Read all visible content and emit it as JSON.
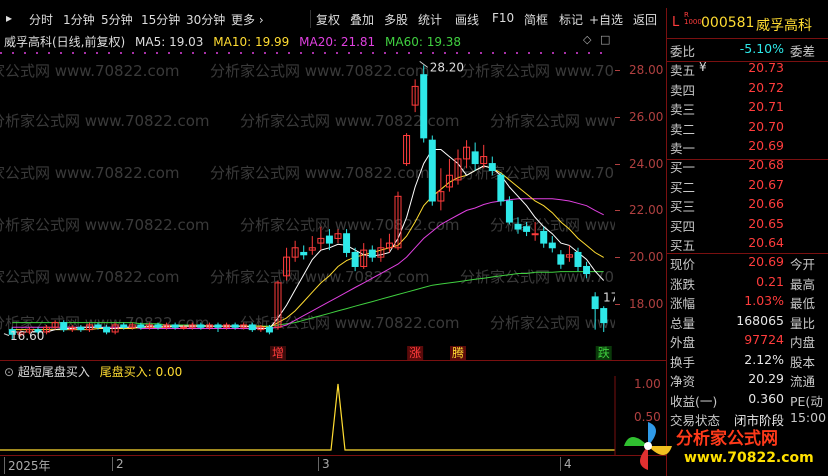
{
  "toolbar": {
    "periods": [
      "分时",
      "1分钟",
      "5分钟",
      "15分钟",
      "30分钟",
      "更多 ›"
    ],
    "buttons": [
      "复权",
      "叠加",
      "多股",
      "统计",
      "画线",
      "F10",
      "简框",
      "标记",
      "+自选",
      "返回"
    ]
  },
  "chart": {
    "title": "威孚高科(日线,前复权)",
    "ma5": "MA5: 19.03",
    "ma10": "MA10: 19.99",
    "ma20": "MA20: 21.81",
    "ma60": "MA60: 19.38",
    "high_label": "28.20",
    "low_label": "16.60",
    "right_edge_label": "17",
    "price_ticks": [
      "28.00",
      "26.00",
      "24.00",
      "22.00",
      "20.00",
      "18.00"
    ],
    "date_labels": [
      "2025年",
      "2",
      "3",
      "4"
    ],
    "markers": [
      "增",
      "涨",
      "腾",
      "跌"
    ],
    "watermark": "分析家公式网 www.70822.com",
    "colors": {
      "up": "#ff3c3c",
      "down": "#2ee8e8",
      "ma5": "#ffffff",
      "ma10": "#ffdc32",
      "ma20": "#e040e0",
      "ma60": "#40d040"
    },
    "candles": [
      {
        "o": 16.9,
        "c": 16.7,
        "h": 17.0,
        "l": 16.5
      },
      {
        "o": 16.7,
        "c": 16.8,
        "h": 16.9,
        "l": 16.6
      },
      {
        "o": 16.8,
        "c": 16.9,
        "h": 17.0,
        "l": 16.7
      },
      {
        "o": 16.9,
        "c": 16.8,
        "h": 17.0,
        "l": 16.7
      },
      {
        "o": 16.8,
        "c": 17.0,
        "h": 17.1,
        "l": 16.7
      },
      {
        "o": 17.0,
        "c": 17.2,
        "h": 17.3,
        "l": 16.9
      },
      {
        "o": 17.2,
        "c": 16.9,
        "h": 17.3,
        "l": 16.8
      },
      {
        "o": 16.9,
        "c": 17.0,
        "h": 17.1,
        "l": 16.8
      },
      {
        "o": 17.0,
        "c": 16.9,
        "h": 17.1,
        "l": 16.8
      },
      {
        "o": 16.9,
        "c": 17.1,
        "h": 17.2,
        "l": 16.8
      },
      {
        "o": 17.1,
        "c": 17.0,
        "h": 17.2,
        "l": 16.9
      },
      {
        "o": 17.0,
        "c": 16.8,
        "h": 17.1,
        "l": 16.7
      },
      {
        "o": 16.8,
        "c": 17.1,
        "h": 17.2,
        "l": 16.7
      },
      {
        "o": 17.1,
        "c": 17.0,
        "h": 17.2,
        "l": 16.9
      },
      {
        "o": 17.0,
        "c": 17.1,
        "h": 17.2,
        "l": 16.9
      },
      {
        "o": 17.1,
        "c": 17.0,
        "h": 17.2,
        "l": 16.9
      },
      {
        "o": 17.0,
        "c": 17.1,
        "h": 17.2,
        "l": 16.9
      },
      {
        "o": 17.1,
        "c": 17.0,
        "h": 17.2,
        "l": 16.9
      },
      {
        "o": 17.0,
        "c": 17.1,
        "h": 17.2,
        "l": 16.9
      },
      {
        "o": 17.1,
        "c": 17.0,
        "h": 17.2,
        "l": 16.9
      },
      {
        "o": 17.0,
        "c": 17.0,
        "h": 17.1,
        "l": 16.9
      },
      {
        "o": 17.0,
        "c": 17.1,
        "h": 17.2,
        "l": 16.9
      },
      {
        "o": 17.1,
        "c": 17.0,
        "h": 17.2,
        "l": 16.9
      },
      {
        "o": 17.0,
        "c": 17.1,
        "h": 17.2,
        "l": 16.9
      },
      {
        "o": 17.1,
        "c": 17.0,
        "h": 17.2,
        "l": 16.8
      },
      {
        "o": 17.0,
        "c": 17.1,
        "h": 17.2,
        "l": 16.9
      },
      {
        "o": 17.1,
        "c": 17.0,
        "h": 17.2,
        "l": 16.9
      },
      {
        "o": 17.0,
        "c": 17.1,
        "h": 17.2,
        "l": 16.9
      },
      {
        "o": 17.1,
        "c": 16.9,
        "h": 17.2,
        "l": 16.8
      },
      {
        "o": 16.9,
        "c": 17.0,
        "h": 17.1,
        "l": 16.8
      },
      {
        "o": 17.0,
        "c": 16.8,
        "h": 17.1,
        "l": 16.7
      },
      {
        "o": 17.0,
        "c": 18.9,
        "h": 19.0,
        "l": 16.9
      },
      {
        "o": 19.2,
        "c": 20.0,
        "h": 20.4,
        "l": 19.0
      },
      {
        "o": 20.0,
        "c": 20.4,
        "h": 20.7,
        "l": 19.8
      },
      {
        "o": 20.2,
        "c": 20.1,
        "h": 20.5,
        "l": 19.9
      },
      {
        "o": 20.3,
        "c": 20.4,
        "h": 20.9,
        "l": 20.1
      },
      {
        "o": 20.6,
        "c": 20.8,
        "h": 21.3,
        "l": 20.3
      },
      {
        "o": 20.9,
        "c": 20.6,
        "h": 21.2,
        "l": 20.3
      },
      {
        "o": 20.8,
        "c": 21.0,
        "h": 21.2,
        "l": 20.6
      },
      {
        "o": 21.0,
        "c": 20.2,
        "h": 21.2,
        "l": 20.0
      },
      {
        "o": 20.2,
        "c": 19.6,
        "h": 20.4,
        "l": 19.4
      },
      {
        "o": 19.6,
        "c": 20.3,
        "h": 20.6,
        "l": 19.5
      },
      {
        "o": 20.3,
        "c": 20.0,
        "h": 20.5,
        "l": 19.8
      },
      {
        "o": 20.0,
        "c": 20.4,
        "h": 20.8,
        "l": 19.8
      },
      {
        "o": 20.4,
        "c": 20.6,
        "h": 21.0,
        "l": 20.2
      },
      {
        "o": 20.4,
        "c": 22.6,
        "h": 22.8,
        "l": 20.3
      },
      {
        "o": 24.0,
        "c": 25.2,
        "h": 25.3,
        "l": 23.9
      },
      {
        "o": 26.5,
        "c": 27.3,
        "h": 27.6,
        "l": 26.2
      },
      {
        "o": 27.8,
        "c": 25.1,
        "h": 28.2,
        "l": 24.9
      },
      {
        "o": 25.0,
        "c": 22.4,
        "h": 25.2,
        "l": 22.2
      },
      {
        "o": 22.4,
        "c": 22.8,
        "h": 23.8,
        "l": 22.0
      },
      {
        "o": 23.0,
        "c": 23.5,
        "h": 24.2,
        "l": 22.8
      },
      {
        "o": 23.3,
        "c": 24.2,
        "h": 24.6,
        "l": 23.1
      },
      {
        "o": 24.2,
        "c": 24.7,
        "h": 25.0,
        "l": 23.8
      },
      {
        "o": 24.5,
        "c": 24.0,
        "h": 24.9,
        "l": 23.7
      },
      {
        "o": 24.0,
        "c": 24.3,
        "h": 24.8,
        "l": 23.8
      },
      {
        "o": 24.0,
        "c": 23.7,
        "h": 24.3,
        "l": 23.5
      },
      {
        "o": 23.5,
        "c": 22.4,
        "h": 23.6,
        "l": 22.2
      },
      {
        "o": 22.4,
        "c": 21.5,
        "h": 22.6,
        "l": 21.4
      },
      {
        "o": 21.4,
        "c": 21.2,
        "h": 21.7,
        "l": 21.0
      },
      {
        "o": 21.3,
        "c": 21.1,
        "h": 21.5,
        "l": 20.9
      },
      {
        "o": 21.0,
        "c": 21.0,
        "h": 21.5,
        "l": 20.7
      },
      {
        "o": 21.1,
        "c": 20.6,
        "h": 21.3,
        "l": 20.4
      },
      {
        "o": 20.6,
        "c": 20.4,
        "h": 20.9,
        "l": 20.2
      },
      {
        "o": 20.1,
        "c": 19.7,
        "h": 20.3,
        "l": 19.5
      },
      {
        "o": 20.0,
        "c": 20.1,
        "h": 20.5,
        "l": 19.8
      },
      {
        "o": 20.2,
        "c": 19.6,
        "h": 20.4,
        "l": 19.4
      },
      {
        "o": 19.6,
        "c": 19.3,
        "h": 19.8,
        "l": 19.1
      },
      {
        "o": 18.3,
        "c": 17.8,
        "h": 18.5,
        "l": 16.9
      },
      {
        "o": 17.8,
        "c": 17.2,
        "h": 17.9,
        "l": 16.8
      }
    ],
    "ma5_series": [
      16.8,
      16.8,
      16.8,
      16.8,
      16.8,
      16.9,
      16.95,
      16.95,
      17.0,
      17.0,
      17.0,
      16.95,
      16.95,
      17.0,
      17.0,
      17.0,
      17.05,
      17.05,
      17.05,
      17.05,
      17.05,
      17.05,
      17.05,
      17.05,
      17.05,
      17.05,
      17.05,
      17.05,
      17.0,
      16.95,
      16.95,
      17.4,
      17.95,
      18.6,
      19.25,
      19.9,
      20.3,
      20.4,
      20.55,
      20.5,
      20.3,
      20.1,
      20.05,
      20.1,
      20.2,
      20.8,
      21.7,
      23.0,
      24.0,
      24.6,
      24.6,
      24.3,
      24.0,
      23.5,
      23.7,
      23.9,
      23.8,
      23.5,
      23.0,
      22.6,
      22.2,
      21.7,
      21.3,
      21.0,
      20.6,
      20.5,
      20.2,
      19.9,
      19.4,
      19.0
    ],
    "ma10_series": [
      16.9,
      16.9,
      16.9,
      16.9,
      16.9,
      16.9,
      16.9,
      16.9,
      16.9,
      16.9,
      16.95,
      16.95,
      16.95,
      16.95,
      16.95,
      17.0,
      17.0,
      17.0,
      17.0,
      17.05,
      17.05,
      17.05,
      17.05,
      17.05,
      17.05,
      17.05,
      17.05,
      17.05,
      17.05,
      17.05,
      17.0,
      17.2,
      17.4,
      17.7,
      18.1,
      18.5,
      18.9,
      19.2,
      19.6,
      19.85,
      20.0,
      20.1,
      20.2,
      20.3,
      20.4,
      20.5,
      20.9,
      21.5,
      22.2,
      22.6,
      22.9,
      23.2,
      23.4,
      23.5,
      23.7,
      23.9,
      23.8,
      23.6,
      23.3,
      23.0,
      22.7,
      22.4,
      22.2,
      21.9,
      21.5,
      21.2,
      20.8,
      20.5,
      20.2,
      19.99
    ],
    "ma20_series": [
      17.0,
      17.0,
      17.0,
      17.0,
      17.0,
      17.0,
      17.0,
      17.0,
      17.0,
      17.0,
      17.0,
      17.0,
      17.0,
      17.0,
      17.0,
      16.95,
      16.95,
      16.95,
      16.95,
      16.95,
      16.95,
      16.95,
      16.95,
      16.95,
      16.95,
      16.95,
      16.95,
      16.95,
      16.95,
      16.95,
      16.95,
      17.0,
      17.1,
      17.3,
      17.5,
      17.7,
      17.9,
      18.1,
      18.3,
      18.5,
      18.7,
      18.9,
      19.1,
      19.3,
      19.5,
      19.7,
      20.0,
      20.4,
      20.8,
      21.1,
      21.4,
      21.6,
      21.8,
      22.0,
      22.1,
      22.25,
      22.35,
      22.4,
      22.45,
      22.5,
      22.5,
      22.5,
      22.5,
      22.5,
      22.45,
      22.4,
      22.3,
      22.2,
      22.0,
      21.81
    ],
    "ma60_series": [
      17.2,
      17.2,
      17.2,
      17.2,
      17.2,
      17.2,
      17.2,
      17.2,
      17.2,
      17.2,
      17.2,
      17.2,
      17.2,
      17.2,
      17.2,
      17.15,
      17.15,
      17.15,
      17.1,
      17.1,
      17.1,
      17.1,
      17.1,
      17.05,
      17.05,
      17.05,
      17.05,
      17.05,
      17.05,
      17.05,
      17.05,
      17.1,
      17.15,
      17.2,
      17.3,
      17.4,
      17.5,
      17.6,
      17.7,
      17.8,
      17.9,
      18.0,
      18.1,
      18.2,
      18.3,
      18.4,
      18.5,
      18.6,
      18.7,
      18.8,
      18.85,
      18.9,
      18.95,
      19.0,
      19.05,
      19.1,
      19.15,
      19.2,
      19.25,
      19.3,
      19.3,
      19.35,
      19.35,
      19.35,
      19.38,
      19.38,
      19.38,
      19.38,
      19.38,
      19.38
    ]
  },
  "indicator": {
    "name": "超短尾盘买入",
    "series_label": "尾盘买入: 0.00",
    "ticks": [
      "1.00",
      "0.50"
    ],
    "signal_values": [
      0,
      0,
      0,
      0,
      0,
      0,
      0,
      0,
      0,
      0,
      0,
      0,
      0,
      0,
      0,
      0,
      0,
      0,
      0,
      0,
      0,
      0,
      0,
      0,
      0,
      0,
      0,
      0,
      0,
      0,
      0,
      0,
      0,
      0,
      0,
      0,
      0,
      0,
      0,
      0,
      0,
      0,
      0,
      0,
      0,
      0,
      0,
      0,
      0,
      0,
      0,
      0,
      0,
      0,
      0,
      0,
      0,
      0,
      0,
      0,
      0,
      0,
      0,
      0,
      0,
      0,
      0,
      0,
      0,
      0
    ],
    "spike_value": 1.0
  },
  "quote": {
    "code": "000581",
    "name": "威孚高科",
    "weibi_label": "委比",
    "weibi_value": "-5.10%",
    "weicha_label": "委差",
    "asks": [
      {
        "label": "卖五",
        "price": "20.73"
      },
      {
        "label": "卖四",
        "price": "20.72"
      },
      {
        "label": "卖三",
        "price": "20.71"
      },
      {
        "label": "卖二",
        "price": "20.70"
      },
      {
        "label": "卖一",
        "price": "20.69"
      }
    ],
    "bids": [
      {
        "label": "买一",
        "price": "20.68"
      },
      {
        "label": "买二",
        "price": "20.67"
      },
      {
        "label": "买三",
        "price": "20.66"
      },
      {
        "label": "买四",
        "price": "20.65"
      },
      {
        "label": "买五",
        "price": "20.64"
      }
    ],
    "stats": [
      {
        "label": "现价",
        "value": "20.69",
        "right": "今开",
        "color": "red"
      },
      {
        "label": "涨跌",
        "value": "0.21",
        "right": "最高",
        "color": "red"
      },
      {
        "label": "涨幅",
        "value": "1.03%",
        "right": "最低",
        "color": "red"
      },
      {
        "label": "总量",
        "value": "168065",
        "right": "量比",
        "color": "wht"
      },
      {
        "label": "外盘",
        "value": "97724",
        "right": "内盘",
        "color": "red"
      },
      {
        "label": "换手",
        "value": "2.12%",
        "right": "股本",
        "color": "wht"
      },
      {
        "label": "净资",
        "value": "20.29",
        "right": "流通",
        "color": "wht"
      },
      {
        "label": "收益(一)",
        "value": "0.360",
        "right": "PE(动",
        "color": "wht"
      },
      {
        "label": "交易状态",
        "value": "闭市阶段",
        "right": "15:00",
        "color": "wht"
      }
    ]
  },
  "logo": {
    "text": "分析家公式网",
    "url_text": "www.70822.com"
  }
}
